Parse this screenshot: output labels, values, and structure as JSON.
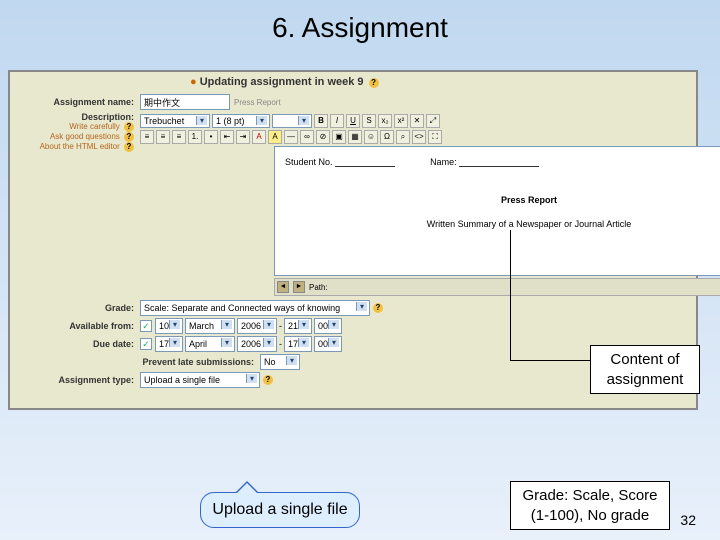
{
  "slide": {
    "title": "6. Assignment",
    "page_number": "32"
  },
  "page_heading": "Updating assignment in week 9",
  "labels": {
    "assignment_name": "Assignment name:",
    "description": "Description:",
    "grade": "Grade:",
    "available_from": "Available from:",
    "due_date": "Due date:",
    "prevent_late": "Prevent late submissions:",
    "assignment_type": "Assignment type:",
    "path": "Path:"
  },
  "help": {
    "write_carefully": "Write carefully",
    "ask_questions": "Ask good questions",
    "about_editor": "About the HTML editor"
  },
  "fields": {
    "assignment_name": "期中作文",
    "assignment_name_hint": "Press Report",
    "font": "Trebuchet",
    "size": "1 (8 pt)",
    "student_no_label": "Student No.",
    "name_label": "Name:",
    "press_report": "Press Report",
    "summary_line": "Written Summary of a Newspaper or Journal Article",
    "grade": "Scale: Separate and Connected ways of knowing",
    "avail_day": "10",
    "avail_month": "March",
    "avail_year": "2006",
    "avail_hh": "21",
    "avail_mm": "00",
    "due_day": "17",
    "due_month": "April",
    "due_year": "2006",
    "due_hh": "17",
    "due_mm": "00",
    "prevent_late": "No",
    "assignment_type": "Upload a single file"
  },
  "annotations": {
    "content": "Content of assignment",
    "upload": "Upload a single file",
    "grade": "Grade: Scale, Score (1-100), No grade"
  }
}
